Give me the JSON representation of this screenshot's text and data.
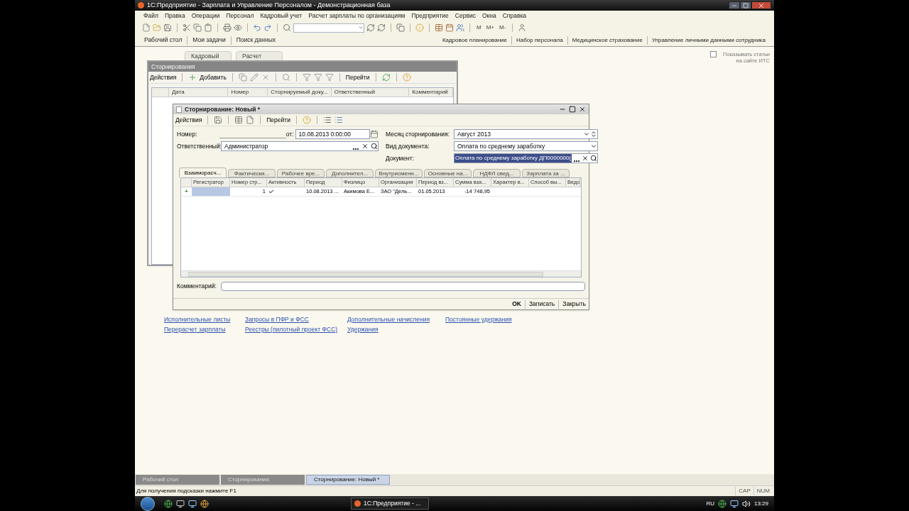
{
  "window": {
    "title": "1С:Предприятие - Зарплата и Управление Персоналом - Демонстрационная база"
  },
  "menu": [
    "Файл",
    "Правка",
    "Операции",
    "Персонал",
    "Кадровый учет",
    "Расчет зарплаты по организациям",
    "Предприятие",
    "Сервис",
    "Окна",
    "Справка"
  ],
  "toolbar": {
    "memory_buttons": [
      "M",
      "M+",
      "M-"
    ]
  },
  "panel_left": [
    "Рабочий стол",
    "Мои задачи",
    "Поиск данных"
  ],
  "panel_right": [
    "Кадровое планирование",
    "Набор персонала",
    "Медицинское страхование",
    "Управление личными данными сотрудника"
  ],
  "desktop": {
    "tabs": [
      "Кадровый",
      "Расчет"
    ],
    "its_checkbox": {
      "label": "Показывать статьи на сайте ИТС",
      "checked": false
    },
    "links": [
      [
        "Исполнительные листы",
        "Перерасчет зарплаты"
      ],
      [
        "Запросы в ПФР и ФСС",
        "Реестры (пилотный проект ФСС)"
      ],
      [
        "Дополнительные начисления",
        "Удержания"
      ],
      [
        "Постоянные удержания"
      ]
    ]
  },
  "list_window": {
    "title": "Сторнирования",
    "actions": "Действия",
    "add": "Добавить",
    "goto": "Перейти",
    "columns": [
      "Дата",
      "Номер",
      "Сторнируемый доку...",
      "Ответственный",
      "Комментарий"
    ]
  },
  "form": {
    "title": "Сторнирование: Новый *",
    "actions": "Действия",
    "goto": "Перейти",
    "number_label": "Номер:",
    "date_label": "от:",
    "date": "10.08.2013  0:00:00",
    "month_label": "Месяц сторнирования:",
    "month": "Август 2013",
    "responsible_label": "Ответственный:",
    "responsible": "Администратор",
    "doctype_label": "Вид документа:",
    "doctype": "Оплата по среднему заработку",
    "document_label": "Документ:",
    "document": "Оплата по среднему заработку ДП0000000(",
    "tabs": [
      {
        "label": "Взаиморасч...",
        "selected": true
      },
      {
        "label": "Фактически...",
        "selected": false
      },
      {
        "label": "Рабочее вре...",
        "selected": false
      },
      {
        "label": "Дополнител...",
        "selected": false
      },
      {
        "label": "Внутрисменн...",
        "selected": false
      },
      {
        "label": "Основные на...",
        "selected": false
      },
      {
        "label": "НДФЛ свед...",
        "selected": false
      },
      {
        "label": "Зарплата за ...",
        "selected": false
      }
    ],
    "columns": [
      "Регистратор",
      "Номер стр...",
      "Активность",
      "Период",
      "Физлицо",
      "Организация",
      "Период вз...",
      "Сумма вза...",
      "Характер в...",
      "Способ вы...",
      "Ведо"
    ],
    "rows": [
      {
        "marker": "+",
        "registrar_selected": true,
        "line": "1",
        "active": true,
        "period": "10.08.2013 ...",
        "person": "Акимова Е...",
        "organization": "ЗАО \"Дель...",
        "accrual_period": "01.05.2013",
        "amount": "-14 748,95"
      }
    ],
    "comment_label": "Комментарий:",
    "buttons": [
      "OK",
      "Записать",
      "Закрыть"
    ]
  },
  "mdi_tasks": [
    {
      "label": "Рабочий стол",
      "selected": false
    },
    {
      "label": "Сторнирования",
      "selected": false
    },
    {
      "label": "Сторнирование: Новый *",
      "selected": true
    }
  ],
  "status_bar": {
    "hint": "Для получения подсказки нажмите F1",
    "indicators": [
      "CAP",
      "NUM"
    ]
  },
  "taskbar": {
    "task": "1С:Предприятие - ...",
    "language": "RU",
    "time": "13:29"
  }
}
